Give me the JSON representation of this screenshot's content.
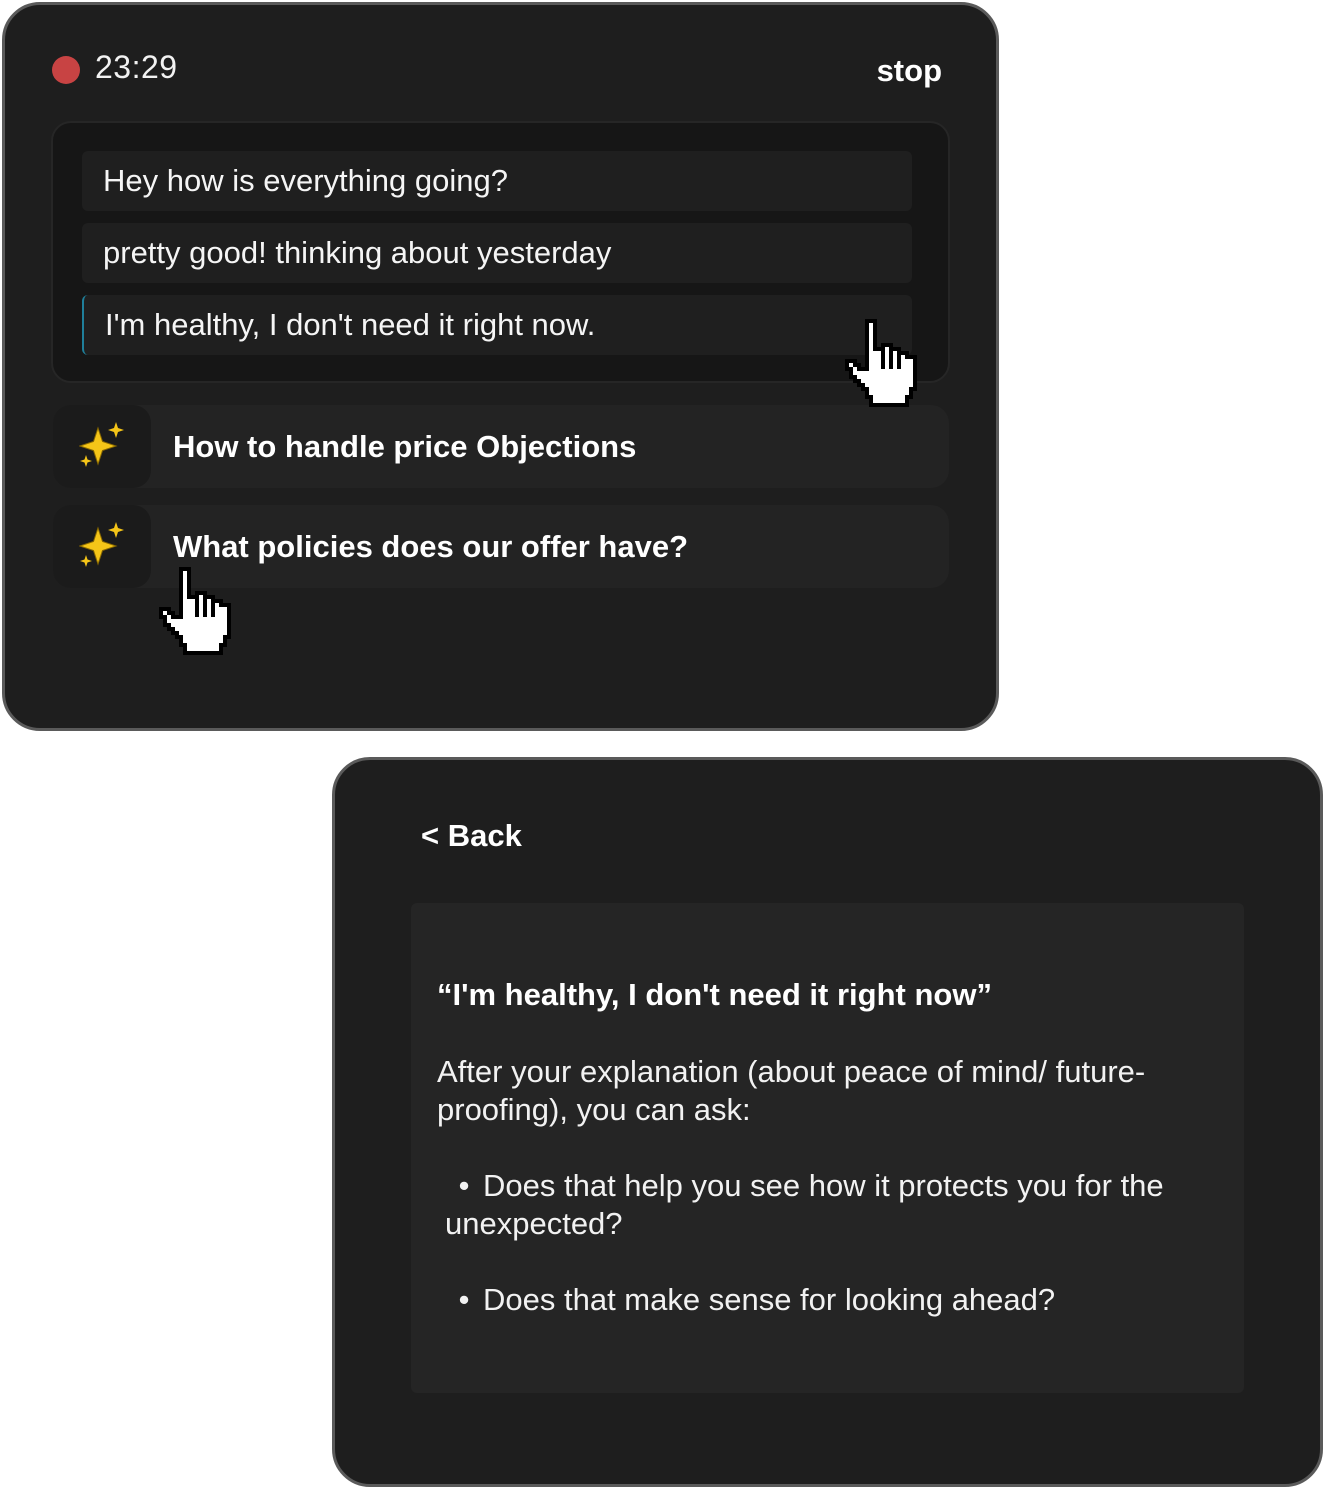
{
  "session": {
    "timer": "23:29",
    "stop_label": "stop"
  },
  "transcript": {
    "lines": [
      "Hey how is everything going?",
      "pretty good! thinking about yesterday",
      "I'm healthy, I don't need it right now."
    ]
  },
  "suggestions": [
    {
      "icon": "sparkles-icon",
      "label": "How to handle price Objections"
    },
    {
      "icon": "sparkles-icon",
      "label": "What policies does our offer have?"
    }
  ],
  "detail": {
    "back_label": "< Back",
    "quote": "“I'm healthy, I don't need it right now”",
    "explanation": "After your explanation (about peace of mind/ future-proofing), you can ask:",
    "questions": [
      "Does that help you see how it protects you for the unexpected?",
      "Does that make sense for looking ahead?"
    ]
  },
  "colors": {
    "panel_bg": "#1e1e1e",
    "panel_border": "#5a5a5a",
    "record_dot": "#c84343",
    "sparkle": "#f5c518",
    "highlight_border": "#1f7f9a"
  }
}
